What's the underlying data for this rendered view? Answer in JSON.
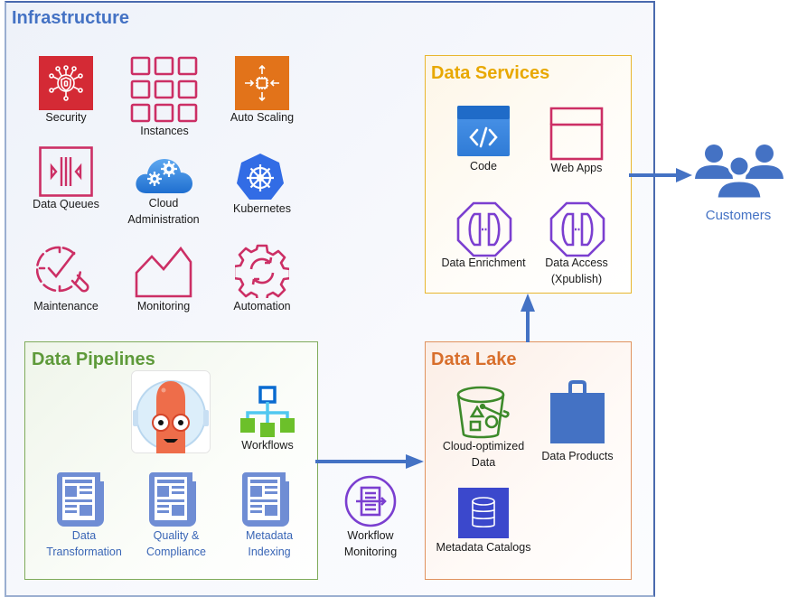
{
  "infrastructure": {
    "title": "Infrastructure",
    "color": "#4472c4",
    "items": [
      {
        "label": "Security",
        "icon": "security-icon"
      },
      {
        "label": "Instances",
        "icon": "instances-icon"
      },
      {
        "label": "Auto Scaling",
        "icon": "auto-scaling-icon"
      },
      {
        "label": "Data Queues",
        "icon": "data-queues-icon"
      },
      {
        "label_line1": "Cloud",
        "label_line2": "Administration",
        "icon": "cloud-administration-icon"
      },
      {
        "label": "Kubernetes",
        "icon": "kubernetes-icon"
      },
      {
        "label": "Maintenance",
        "icon": "maintenance-icon"
      },
      {
        "label": "Monitoring",
        "icon": "monitoring-icon"
      },
      {
        "label": "Automation",
        "icon": "automation-icon"
      }
    ]
  },
  "data_services": {
    "title": "Data Services",
    "color": "#e8a800",
    "items": [
      {
        "label": "Code",
        "icon": "code-icon"
      },
      {
        "label": "Web Apps",
        "icon": "web-apps-icon"
      },
      {
        "label": "Data Enrichment",
        "icon": "data-enrichment-icon"
      },
      {
        "label_line1": "Data Access",
        "label_line2": "(Xpublish)",
        "icon": "data-access-icon"
      }
    ]
  },
  "customers": {
    "label": "Customers",
    "icon": "customers-icon"
  },
  "data_pipelines": {
    "title": "Data Pipelines",
    "color": "#5e9a3a",
    "items": [
      {
        "label": "",
        "icon": "argo-mascot-icon"
      },
      {
        "label": "Workflows",
        "icon": "workflows-icon"
      },
      {
        "label_line1": "Data",
        "label_line2": "Transformation",
        "icon": "document-icon"
      },
      {
        "label_line1": "Quality &",
        "label_line2": "Compliance",
        "icon": "document-icon"
      },
      {
        "label_line1": "Metadata",
        "label_line2": "Indexing",
        "icon": "document-icon"
      }
    ]
  },
  "workflow_monitoring": {
    "label_line1": "Workflow",
    "label_line2": "Monitoring",
    "icon": "workflow-monitoring-icon"
  },
  "data_lake": {
    "title": "Data Lake",
    "color": "#d86f2c",
    "items": [
      {
        "label_line1": "Cloud-optimized",
        "label_line2": "Data",
        "icon": "bucket-icon"
      },
      {
        "label": "Data Products",
        "icon": "shopping-bag-icon"
      },
      {
        "label": "Metadata Catalogs",
        "icon": "database-icon"
      }
    ]
  }
}
